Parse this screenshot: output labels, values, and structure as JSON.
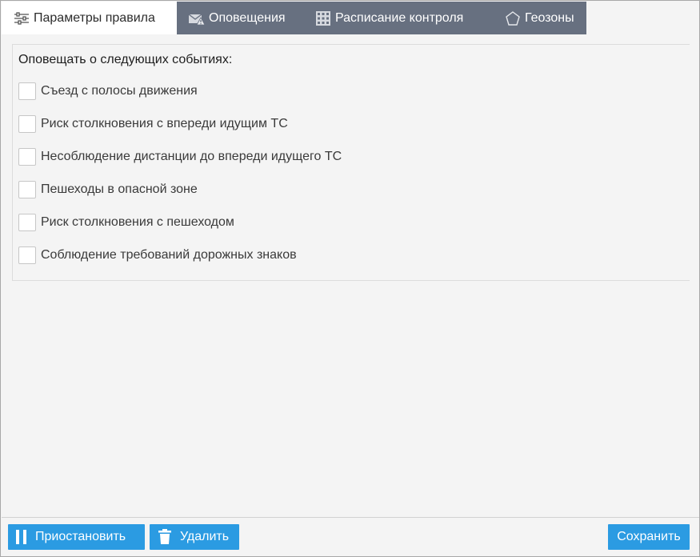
{
  "tabs": [
    {
      "label": "Параметры правила",
      "icon": "sliders-icon",
      "active": true
    },
    {
      "label": "Оповещения",
      "icon": "mail-warning-icon",
      "active": false
    },
    {
      "label": "Расписание контроля",
      "icon": "calendar-grid-icon",
      "active": false
    },
    {
      "label": "Геозоны",
      "icon": "pentagon-icon",
      "active": false
    }
  ],
  "panel": {
    "title": "Оповещать о следующих событиях:",
    "options": [
      {
        "label": "Съезд с полосы движения",
        "checked": false
      },
      {
        "label": "Риск столкновения с впереди идущим ТС",
        "checked": false
      },
      {
        "label": "Несоблюдение дистанции до впереди идущего ТС",
        "checked": false
      },
      {
        "label": "Пешеходы в опасной зоне",
        "checked": false
      },
      {
        "label": "Риск столкновения с пешеходом",
        "checked": false
      },
      {
        "label": "Соблюдение требований дорожных знаков",
        "checked": false
      }
    ]
  },
  "footer": {
    "pause_label": "Приостановить",
    "delete_label": "Удалить",
    "save_label": "Сохранить"
  },
  "colors": {
    "tabbar": "#677080",
    "button": "#2b9be2",
    "background": "#f4f4f4"
  }
}
